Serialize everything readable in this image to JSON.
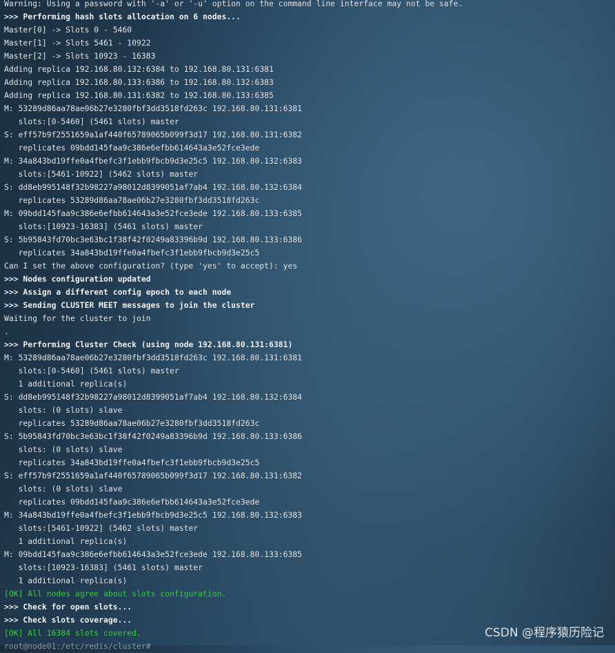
{
  "terminal": {
    "lines": [
      {
        "text": "Warning: Using a password with '-a' or '-u' option on the command line interface may not be safe.",
        "style": "normal"
      },
      {
        "text": ">>> Performing hash slots allocation on 6 nodes...",
        "style": "bold"
      },
      {
        "text": "Master[0] -> Slots 0 - 5460",
        "style": "normal"
      },
      {
        "text": "Master[1] -> Slots 5461 - 10922",
        "style": "normal"
      },
      {
        "text": "Master[2] -> Slots 10923 - 16383",
        "style": "normal"
      },
      {
        "text": "Adding replica 192.168.80.132:6384 to 192.168.80.131:6381",
        "style": "normal"
      },
      {
        "text": "Adding replica 192.168.80.133:6386 to 192.168.80.132:6383",
        "style": "normal"
      },
      {
        "text": "Adding replica 192.168.80.131:6382 to 192.168.80.133:6385",
        "style": "normal"
      },
      {
        "text": "M: 53289d86aa78ae06b27e3280fbf3dd3518fd263c 192.168.80.131:6381",
        "style": "normal"
      },
      {
        "text": "   slots:[0-5460] (5461 slots) master",
        "style": "normal"
      },
      {
        "text": "S: eff57b9f2551659a1af440f65789065b099f3d17 192.168.80.131:6382",
        "style": "normal"
      },
      {
        "text": "   replicates 09bdd145faa9c386e6efbb614643a3e52fce3ede",
        "style": "normal"
      },
      {
        "text": "M: 34a843bd19ffe0a4fbefc3f1ebb9fbcb9d3e25c5 192.168.80.132:6383",
        "style": "normal"
      },
      {
        "text": "   slots:[5461-10922] (5462 slots) master",
        "style": "normal"
      },
      {
        "text": "S: dd8eb995148f32b98227a98012d8399051af7ab4 192.168.80.132:6384",
        "style": "normal"
      },
      {
        "text": "   replicates 53289d86aa78ae06b27e3280fbf3dd3518fd263c",
        "style": "normal"
      },
      {
        "text": "M: 09bdd145faa9c386e6efbb614643a3e52fce3ede 192.168.80.133:6385",
        "style": "normal"
      },
      {
        "text": "   slots:[10923-16383] (5461 slots) master",
        "style": "normal"
      },
      {
        "text": "S: 5b95843fd70bc3e63bc1f38f42f0249a83396b9d 192.168.80.133:6386",
        "style": "normal"
      },
      {
        "text": "   replicates 34a843bd19ffe0a4fbefc3f1ebb9fbcb9d3e25c5",
        "style": "normal"
      },
      {
        "text": "Can I set the above configuration? (type 'yes' to accept): yes",
        "style": "normal"
      },
      {
        "text": ">>> Nodes configuration updated",
        "style": "bold"
      },
      {
        "text": ">>> Assign a different config epoch to each node",
        "style": "bold"
      },
      {
        "text": ">>> Sending CLUSTER MEET messages to join the cluster",
        "style": "bold"
      },
      {
        "text": "Waiting for the cluster to join",
        "style": "normal"
      },
      {
        "text": ".",
        "style": "normal"
      },
      {
        "text": ">>> Performing Cluster Check (using node 192.168.80.131:6381)",
        "style": "bold"
      },
      {
        "text": "M: 53289d86aa78ae06b27e3280fbf3dd3518fd263c 192.168.80.131:6381",
        "style": "normal"
      },
      {
        "text": "   slots:[0-5460] (5461 slots) master",
        "style": "normal"
      },
      {
        "text": "   1 additional replica(s)",
        "style": "normal"
      },
      {
        "text": "S: dd8eb995148f32b98227a98012d8399051af7ab4 192.168.80.132:6384",
        "style": "normal"
      },
      {
        "text": "   slots: (0 slots) slave",
        "style": "normal"
      },
      {
        "text": "   replicates 53289d86aa78ae06b27e3280fbf3dd3518fd263c",
        "style": "normal"
      },
      {
        "text": "S: 5b95843fd70bc3e63bc1f38f42f0249a83396b9d 192.168.80.133:6386",
        "style": "normal"
      },
      {
        "text": "   slots: (0 slots) slave",
        "style": "normal"
      },
      {
        "text": "   replicates 34a843bd19ffe0a4fbefc3f1ebb9fbcb9d3e25c5",
        "style": "normal"
      },
      {
        "text": "S: eff57b9f2551659a1af440f65789065b099f3d17 192.168.80.131:6382",
        "style": "normal"
      },
      {
        "text": "   slots: (0 slots) slave",
        "style": "normal"
      },
      {
        "text": "   replicates 09bdd145faa9c386e6efbb614643a3e52fce3ede",
        "style": "normal"
      },
      {
        "text": "M: 34a843bd19ffe0a4fbefc3f1ebb9fbcb9d3e25c5 192.168.80.132:6383",
        "style": "normal"
      },
      {
        "text": "   slots:[5461-10922] (5462 slots) master",
        "style": "normal"
      },
      {
        "text": "   1 additional replica(s)",
        "style": "normal"
      },
      {
        "text": "M: 09bdd145faa9c386e6efbb614643a3e52fce3ede 192.168.80.133:6385",
        "style": "normal"
      },
      {
        "text": "   slots:[10923-16383] (5461 slots) master",
        "style": "normal"
      },
      {
        "text": "   1 additional replica(s)",
        "style": "normal"
      },
      {
        "text": "[OK] All nodes agree about slots configuration.",
        "style": "ok"
      },
      {
        "text": ">>> Check for open slots...",
        "style": "bold"
      },
      {
        "text": ">>> Check slots coverage...",
        "style": "bold"
      },
      {
        "text": "[OK] All 16384 slots covered.",
        "style": "ok"
      },
      {
        "text": "root@node01:/etc/redis/cluster#",
        "style": "faded"
      }
    ]
  },
  "watermark": {
    "text": "CSDN @程序猿历险记"
  },
  "colors": {
    "text": "#e8ecef",
    "ok": "#3fd64a",
    "background": "#2b4d68"
  }
}
